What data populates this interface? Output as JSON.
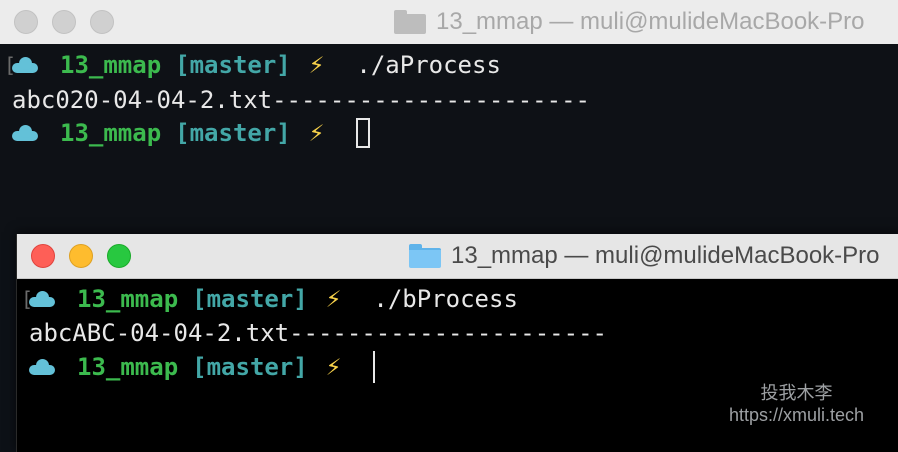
{
  "back_window": {
    "title": "13_mmap — muli@mulideMacBook-Pro",
    "lines": {
      "prompt1": {
        "dir": "13_mmap",
        "branch": "[master]",
        "command": "./aProcess"
      },
      "output": "abc020-04-04-2.txt----------------------",
      "prompt2": {
        "dir": "13_mmap",
        "branch": "[master]"
      }
    }
  },
  "front_window": {
    "title": "13_mmap — muli@mulideMacBook-Pro",
    "lines": {
      "prompt1": {
        "dir": "13_mmap",
        "branch": "[master]",
        "command": "./bProcess"
      },
      "output": "abcABC-04-04-2.txt----------------------",
      "prompt2": {
        "dir": "13_mmap",
        "branch": "[master]"
      }
    }
  },
  "prompt_glyphs": {
    "bolt": "⚡",
    "open_bracket": "["
  },
  "icons": [
    "folder-icon",
    "cloud-icon",
    "bolt-icon"
  ],
  "colors": {
    "dir": "#3cba4e",
    "branch": "#43a7a7",
    "bolt": "#f7d14a",
    "cloud": "#63c1d8"
  },
  "watermark": {
    "name": "投我木李",
    "url": "https://xmuli.tech"
  }
}
